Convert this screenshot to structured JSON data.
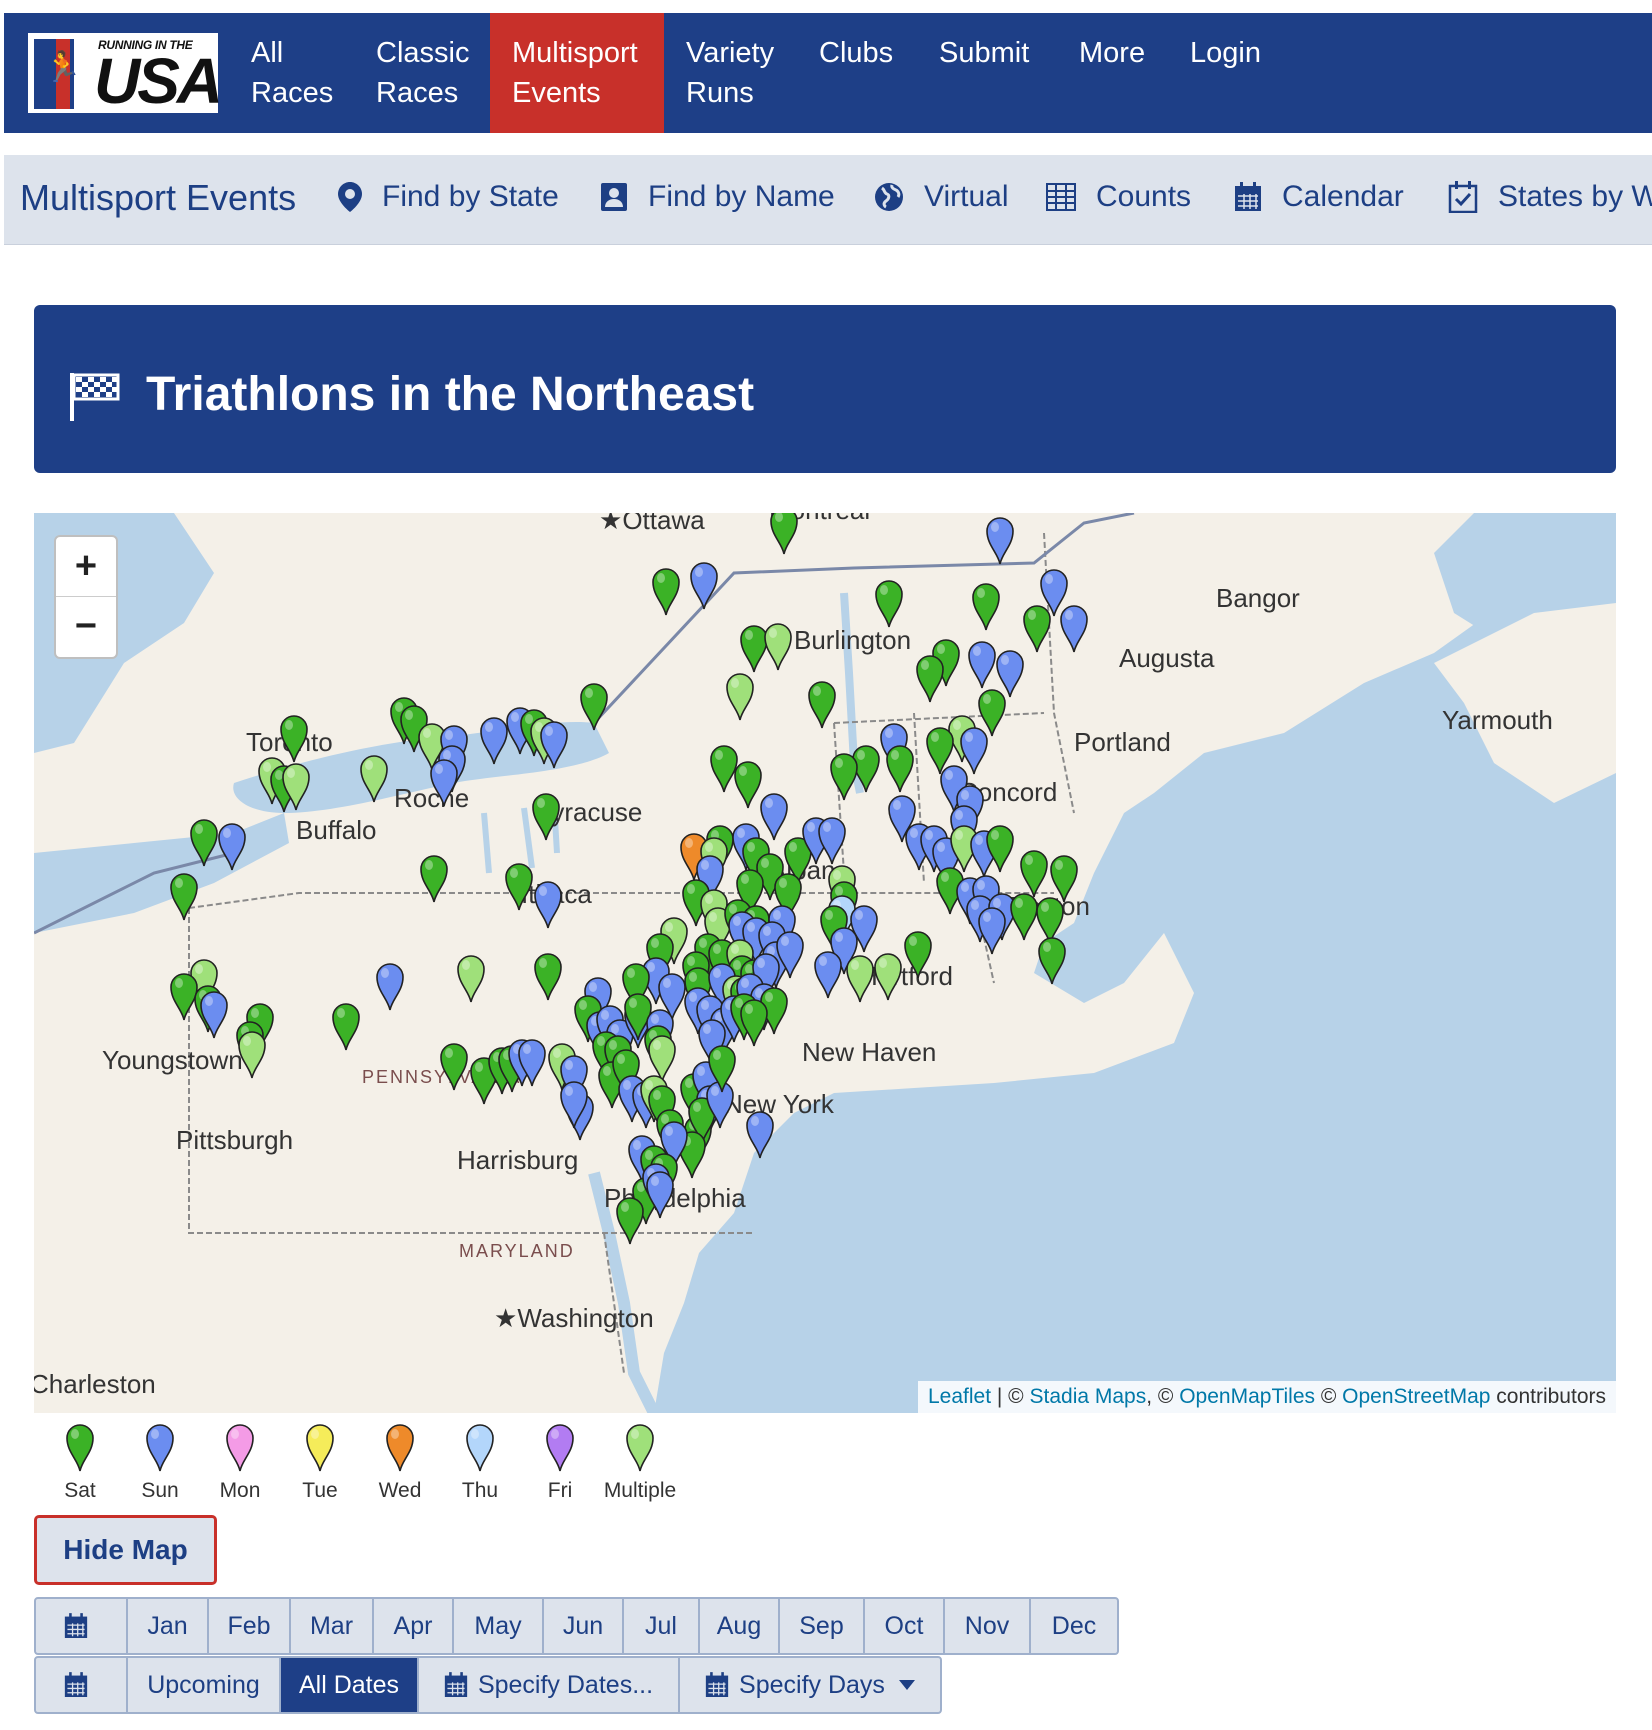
{
  "logo": {
    "tagline": "RUNNING IN THE",
    "word": "USA"
  },
  "topnav": [
    {
      "line1": "All",
      "line2": "Races"
    },
    {
      "line1": "Classic",
      "line2": "Races"
    },
    {
      "line1": "Multisport",
      "line2": "Events"
    },
    {
      "line1": "Variety",
      "line2": "Runs"
    },
    {
      "line1": "Clubs",
      "line2": ""
    },
    {
      "line1": "Submit",
      "line2": ""
    },
    {
      "line1": "More",
      "line2": ""
    },
    {
      "line1": "Login",
      "line2": ""
    }
  ],
  "subnav": {
    "title": "Multisport Events",
    "items": [
      "Find by State",
      "Find by Name",
      "Virtual",
      "Counts",
      "Calendar",
      "States by We"
    ]
  },
  "page_title": "Triathlons in the Northeast",
  "map": {
    "zoom_in": "+",
    "zoom_out": "−",
    "labels": {
      "ottawa": "Ottawa",
      "montreal": "Montreal",
      "bangor": "Bangor",
      "burlington": "Burlington",
      "augusta": "Augusta",
      "yarmouth": "Yarmouth",
      "toronto": "Toronto",
      "portland": "Portland",
      "rochester": "Roche",
      "syracuse": "Syracuse",
      "concord": "Concord",
      "buffalo": "Buffalo",
      "albany": "Alban",
      "ithaca": "Ithaca",
      "boston": "Boston",
      "hartford": "Hartford",
      "youngstown": "Youngstown",
      "pennsylvania": "PENNSYLVANIA",
      "newhaven": "New Haven",
      "newyork": "New York",
      "pittsburgh": "Pittsburgh",
      "harrisburg": "Harrisburg",
      "philadelphia": "Philadelphia",
      "maryland": "MARYLAND",
      "washington": "Washington",
      "charleston": "Charleston"
    },
    "attribution": {
      "leaflet": "Leaflet",
      "sep1": " | © ",
      "stadia": "Stadia Maps",
      "sep2": ", © ",
      "openmaptiles": "OpenMapTiles",
      "sep3": " © ",
      "osm": "OpenStreetMap",
      "tail": " contributors"
    },
    "colors": {
      "Sat": "#3bb226",
      "Sun": "#6b8df0",
      "Mon": "#f49be6",
      "Tue": "#f5ec5a",
      "Wed": "#ee8a2a",
      "Thu": "#b3d6fb",
      "Fri": "#b27cf2",
      "Multiple": "#9fe07a",
      "water": "#b7d2e8",
      "land": "#f4f0e8"
    }
  },
  "legend": [
    {
      "label": "Sat",
      "color": "#3bb226"
    },
    {
      "label": "Sun",
      "color": "#6b8df0"
    },
    {
      "label": "Mon",
      "color": "#f49be6"
    },
    {
      "label": "Tue",
      "color": "#f5ec5a"
    },
    {
      "label": "Wed",
      "color": "#ee8a2a"
    },
    {
      "label": "Thu",
      "color": "#b3d6fb"
    },
    {
      "label": "Fri",
      "color": "#b27cf2"
    },
    {
      "label": "Multiple",
      "color": "#9fe07a"
    }
  ],
  "hide_map": "Hide Map",
  "months": [
    "Jan",
    "Feb",
    "Mar",
    "Apr",
    "May",
    "Jun",
    "Jul",
    "Aug",
    "Sep",
    "Oct",
    "Nov",
    "Dec"
  ],
  "date_filters": {
    "upcoming": "Upcoming",
    "all_dates": "All Dates",
    "specify_dates": "Specify Dates...",
    "specify_days": "Specify Days"
  }
}
